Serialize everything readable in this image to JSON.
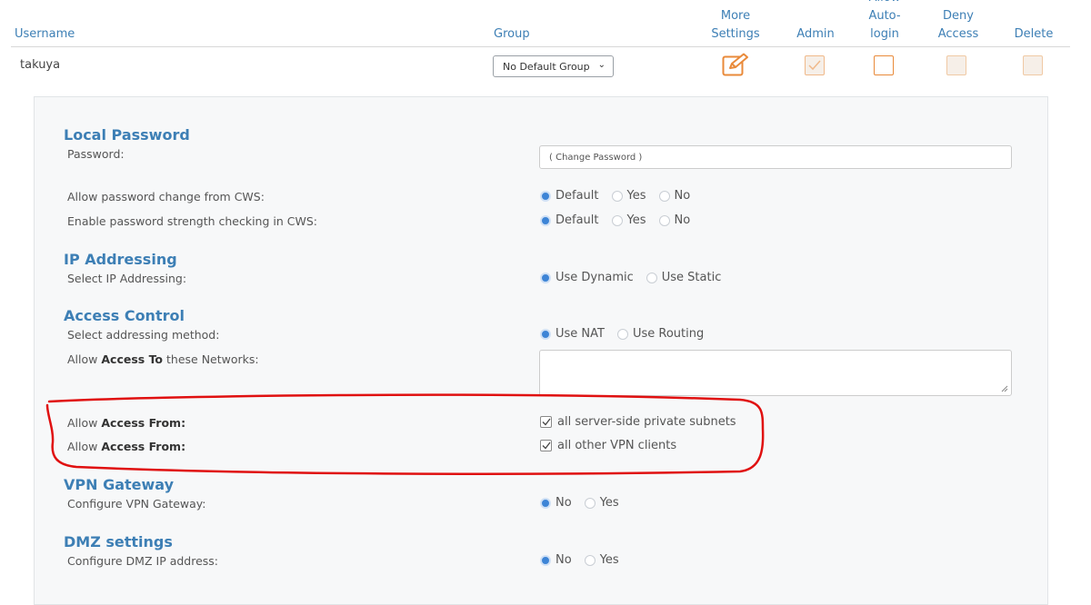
{
  "header": {
    "username": "Username",
    "group": "Group",
    "more_settings": "More Settings",
    "admin": "Admin",
    "allow_autologin": "Allow Auto-login",
    "deny_access": "Deny Access",
    "delete": "Delete"
  },
  "row": {
    "username": "takuya",
    "group_selected": "No Default Group",
    "edit_icon": "pencil-square-icon",
    "admin_checked": true,
    "autologin_checked": false,
    "deny_checked": false,
    "delete_checked": false
  },
  "local_password": {
    "title": "Local Password",
    "password_label": "Password:",
    "password_placeholder": "( Change Password )",
    "allow_change_label": "Allow password change from CWS:",
    "allow_change_options": [
      "Default",
      "Yes",
      "No"
    ],
    "allow_change_selected": "Default",
    "strength_label": "Enable password strength checking in CWS:",
    "strength_options": [
      "Default",
      "Yes",
      "No"
    ],
    "strength_selected": "Default"
  },
  "ip_addressing": {
    "title": "IP Addressing",
    "label": "Select IP Addressing:",
    "options": [
      "Use Dynamic",
      "Use Static"
    ],
    "selected": "Use Dynamic"
  },
  "access_control": {
    "title": "Access Control",
    "method_label": "Select addressing method:",
    "method_options": [
      "Use NAT",
      "Use Routing"
    ],
    "method_selected": "Use NAT",
    "access_to_prefix": "Allow",
    "access_to_bold": "Access To",
    "access_to_suffix": "these Networks:",
    "access_to_value": "",
    "access_from_prefix": "Allow",
    "access_from_bold": "Access From:",
    "access_from_1": "all server-side private subnets",
    "access_from_2": "all other VPN clients"
  },
  "vpn_gateway": {
    "title": "VPN Gateway",
    "label": "Configure VPN Gateway:",
    "options": [
      "No",
      "Yes"
    ],
    "selected": "No"
  },
  "dmz": {
    "title": "DMZ settings",
    "label": "Configure DMZ IP address:",
    "options": [
      "No",
      "Yes"
    ],
    "selected": "No"
  },
  "colors": {
    "accent": "#3d7fb5",
    "checkbox_orange": "#e98a3a",
    "annotation_red": "#e01010"
  }
}
